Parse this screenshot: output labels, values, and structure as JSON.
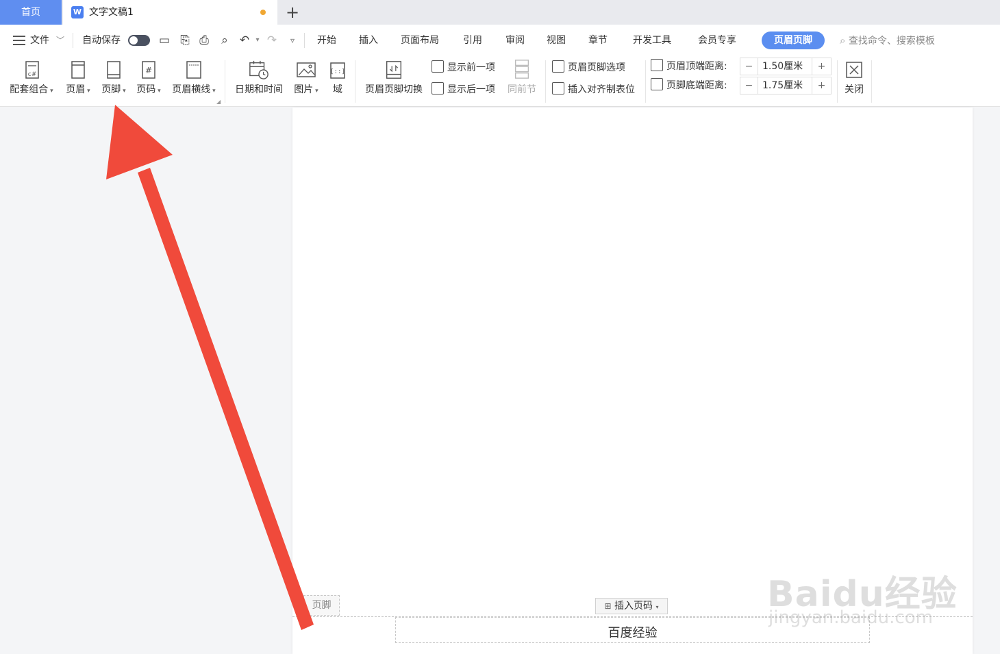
{
  "tabs": {
    "home": "首页",
    "doc_title": "文字文稿1",
    "add": "+"
  },
  "menubar": {
    "file": "文件",
    "autosave": "自动保存",
    "items": [
      "开始",
      "插入",
      "页面布局",
      "引用",
      "审阅",
      "视图",
      "章节",
      "开发工具",
      "会员专享"
    ],
    "active": "页眉页脚",
    "search_placeholder": "查找命令、搜索模板"
  },
  "ribbon": {
    "combo": "配套组合",
    "header": "页眉",
    "footer": "页脚",
    "page_number": "页码",
    "header_line": "页眉横线",
    "datetime": "日期和时间",
    "picture": "图片",
    "field": "域",
    "switch": "页眉页脚切换",
    "show_prev": "显示前一项",
    "show_next": "显示后一项",
    "same_as_prev": "同前节",
    "options": "页眉页脚选项",
    "insert_tab": "插入对齐制表位",
    "header_distance_label": "页眉顶端距离:",
    "header_distance_value": "1.50厘米",
    "footer_distance_label": "页脚底端距离:",
    "footer_distance_value": "1.75厘米",
    "close": "关闭"
  },
  "document": {
    "footer_tag": "页脚",
    "insert_page_number": "插入页码",
    "footer_text": "百度经验"
  },
  "watermark": {
    "text": "Baidu经验",
    "url": "jingyan.baidu.com"
  },
  "colors": {
    "accent": "#5b8ef0",
    "arrow": "#f04a3b"
  }
}
